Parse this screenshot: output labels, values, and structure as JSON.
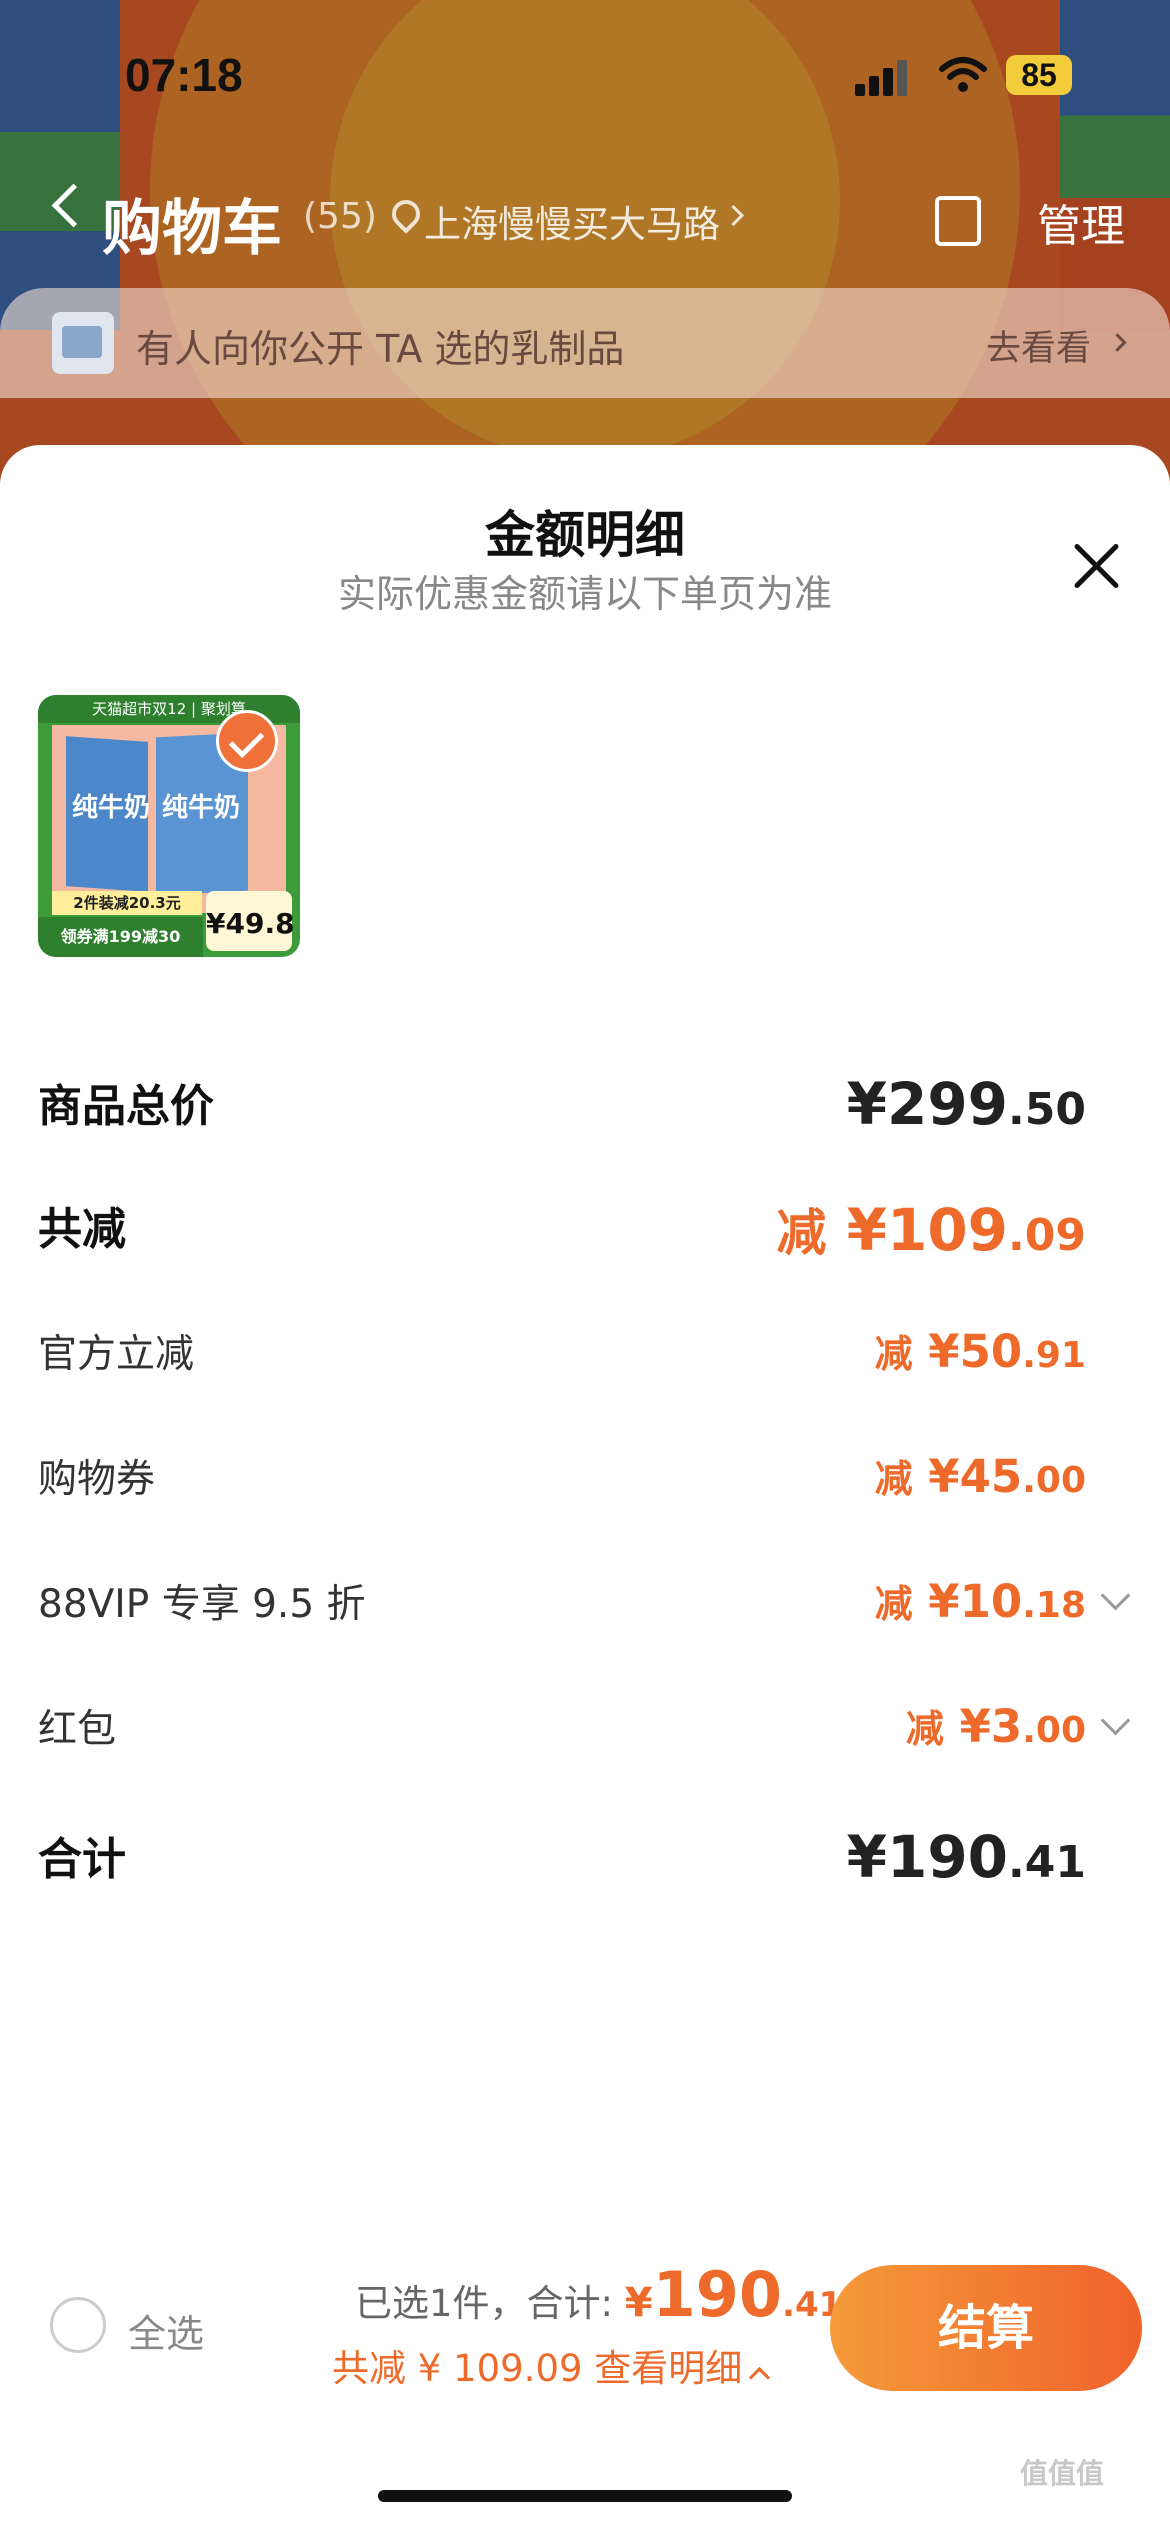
{
  "status_bar": {
    "time": "07:18",
    "battery": "85"
  },
  "header": {
    "title": "购物车",
    "count": "(55)",
    "address": "上海慢慢买大马路",
    "manage_label": "管理"
  },
  "promo": {
    "text": "有人向你公开 TA 选的乳制品",
    "link": "去看看"
  },
  "sheet": {
    "title": "金额明细",
    "subtitle": "实际优惠金额请以下单页为准"
  },
  "product": {
    "top_strip": "天猫超市双12 | 聚划算",
    "name_left": "纯牛奶",
    "name_right": "纯牛奶",
    "promo_bar": "2件装减20.3元",
    "coupon": "领券满199减30",
    "price": "¥49.8"
  },
  "rows": {
    "total": {
      "label": "商品总价",
      "int": "¥299",
      "dec": ".50"
    },
    "reduce": {
      "label": "共减",
      "pre": "减",
      "int": "¥109",
      "dec": ".09"
    },
    "official": {
      "label": "官方立减",
      "pre": "减",
      "int": "¥50",
      "dec": ".91"
    },
    "coupon": {
      "label": "购物券",
      "pre": "减",
      "int": "¥45",
      "dec": ".00"
    },
    "vip": {
      "label": "88VIP 专享 9.5 折",
      "pre": "减",
      "int": "¥10",
      "dec": ".18"
    },
    "redpacket": {
      "label": "红包",
      "pre": "减",
      "int": "¥3",
      "dec": ".00"
    },
    "sum": {
      "label": "合计",
      "int": "¥190",
      "dec": ".41"
    }
  },
  "bottom": {
    "select_all": "全选",
    "summary_prefix": "已选1件，合计: ",
    "total_cur": "¥",
    "total_int": "190",
    "total_dec": ".41",
    "saved": "共减 ¥ 109.09  查看明细",
    "checkout": "结算"
  },
  "watermark": "值值值",
  "colors": {
    "accent": "#ee6a2a",
    "checkout_start": "#f49b3a",
    "checkout_end": "#f0622b"
  }
}
